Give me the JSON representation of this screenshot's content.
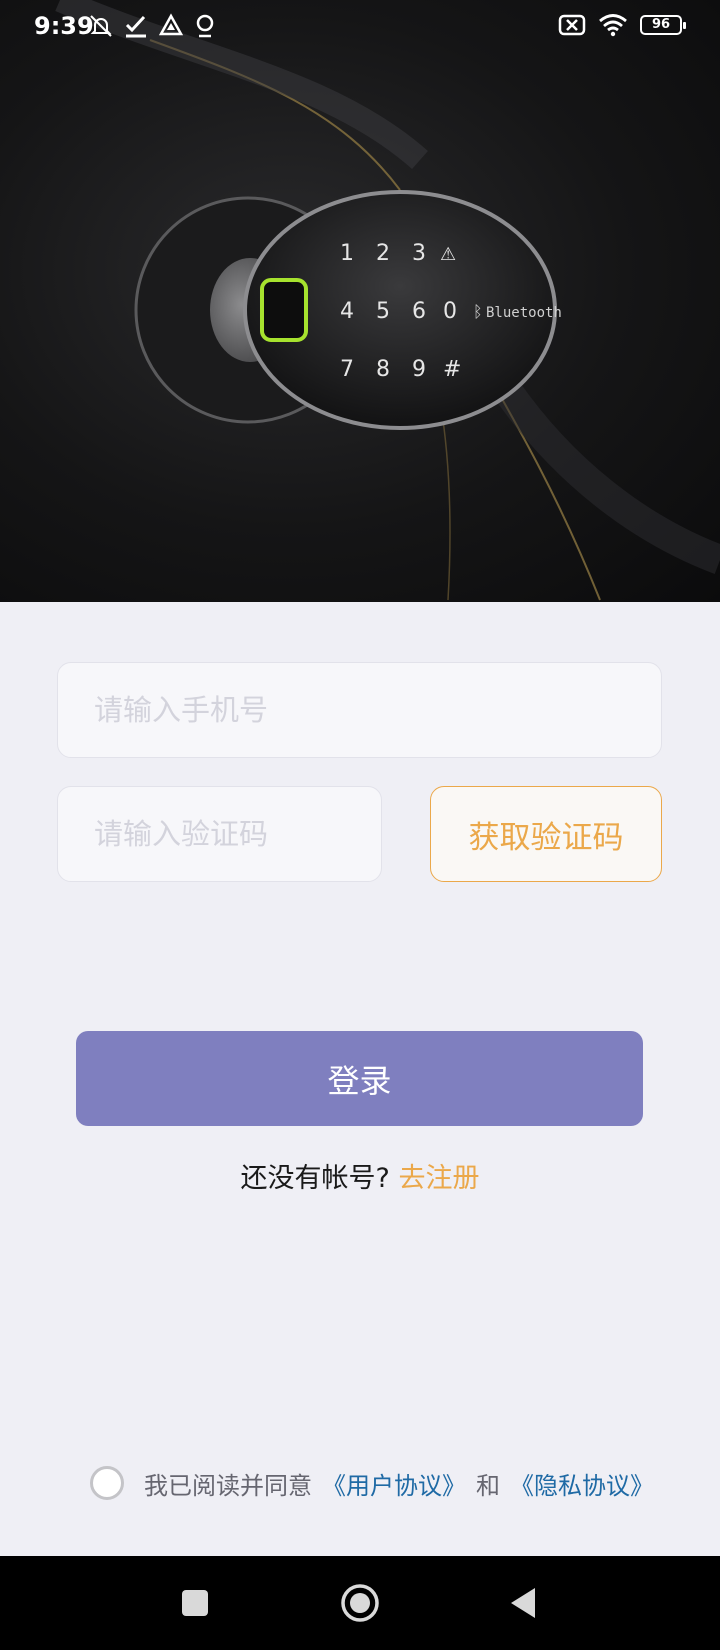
{
  "status_bar": {
    "time": "9:39",
    "battery": "96"
  },
  "hero": {
    "keypad_rows": [
      [
        "1",
        "2",
        "3",
        "⚠"
      ],
      [
        "4",
        "5",
        "6",
        "0"
      ],
      [
        "7",
        "8",
        "9",
        "#"
      ]
    ],
    "bluetooth_label": "Bluetooth"
  },
  "form": {
    "phone_placeholder": "请输入手机号",
    "code_placeholder": "请输入验证码",
    "get_code_label": "获取验证码",
    "login_label": "登录"
  },
  "register": {
    "prompt": "还没有帐号?",
    "link": "去注册"
  },
  "agreement": {
    "prefix": "我已阅读并同意",
    "user_agreement": "《用户协议》",
    "conjunction": "和",
    "privacy_agreement": "《隐私协议》"
  },
  "colors": {
    "accent_orange": "#eba84a",
    "login_purple": "#7f7fbf",
    "link_blue": "#1f6aa5",
    "background": "#efeff5"
  },
  "icons": {
    "status_left": [
      "mute-icon",
      "check-icon",
      "drive-icon",
      "location-icon"
    ],
    "status_right": [
      "sim-off-icon",
      "wifi-icon",
      "battery-icon"
    ],
    "nav": [
      "recents-square-icon",
      "home-circle-icon",
      "back-triangle-icon"
    ]
  }
}
